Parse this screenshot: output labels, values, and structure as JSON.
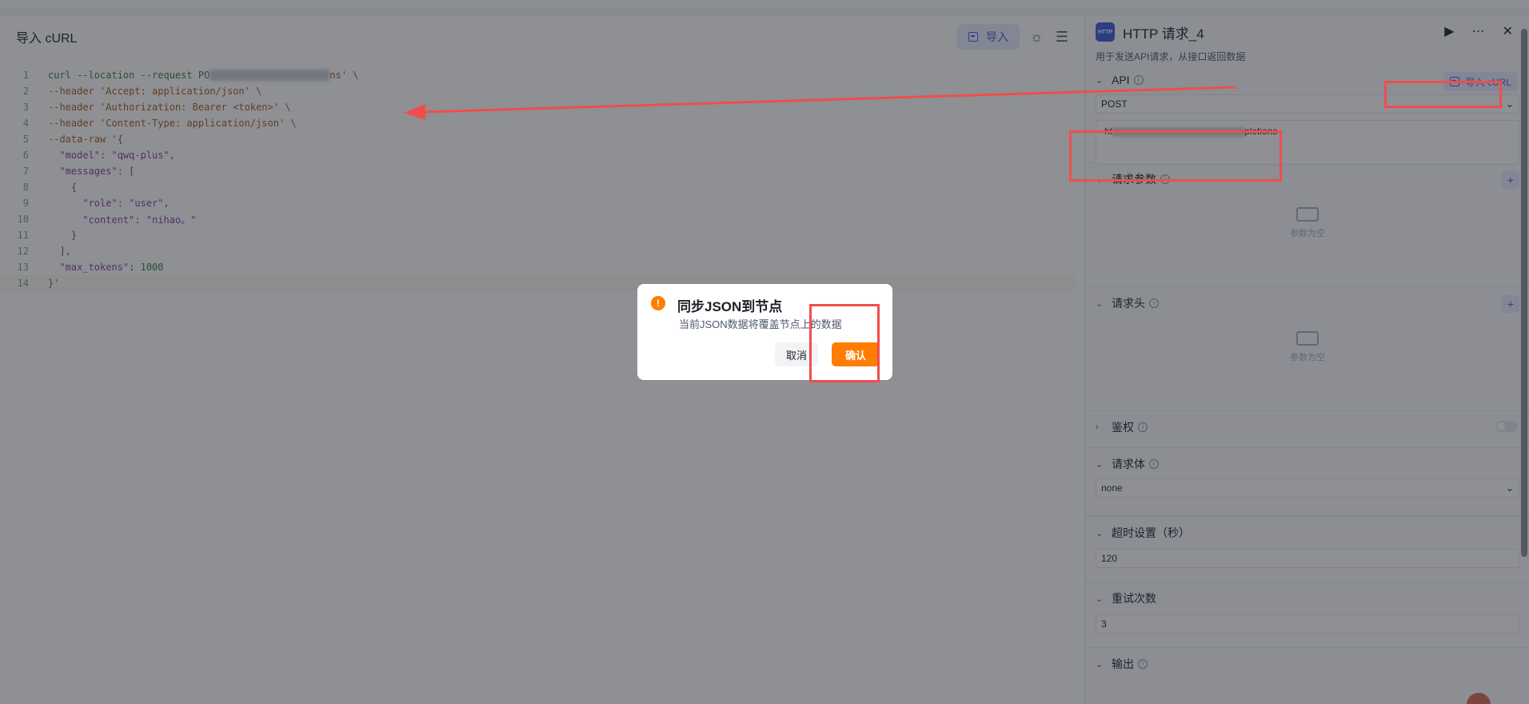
{
  "editor": {
    "title": "导入 cURL",
    "import_label": "导入",
    "lines": [
      {
        "n": "1"
      },
      {
        "n": "2"
      },
      {
        "n": "3"
      },
      {
        "n": "4"
      },
      {
        "n": "5"
      },
      {
        "n": "6"
      },
      {
        "n": "7"
      },
      {
        "n": "8"
      },
      {
        "n": "9"
      },
      {
        "n": "10"
      },
      {
        "n": "11"
      },
      {
        "n": "12"
      },
      {
        "n": "13"
      },
      {
        "n": "14"
      }
    ],
    "code": {
      "l1_cmd": "curl --location --request PO",
      "l1_tail": "ns' \\",
      "l2": "--header 'Accept: application/json' \\",
      "l3": "--header 'Authorization: Bearer <token>' \\",
      "l4": "--header 'Content-Type: application/json' \\",
      "l5_opt": "--data-raw '",
      "l5_brace": "{",
      "l6_key": "\"model\"",
      "l6_val": ": \"qwq-plus\",",
      "l7_key": "\"messages\"",
      "l7_val": ": [",
      "l8": "{",
      "l9_key": "\"role\"",
      "l9_val": ": \"user\",",
      "l10_key": "\"content\"",
      "l10_val": ": \"nihao。\"",
      "l11": "}",
      "l12": "],",
      "l13_key": "\"max_tokens\"",
      "l13_val": "1000",
      "l14": "}'"
    }
  },
  "node": {
    "title": "HTTP 请求_4",
    "logo_text": "HTTP",
    "description": "用于发送API请求，从接口返回数据",
    "api_label": "API",
    "import_curl_label": "导入 cURL",
    "method": "POST",
    "url_prefix": "ht",
    "url_suffix": "pletions",
    "params_label": "请求参数",
    "params_empty": "参数为空",
    "headers_label": "请求头",
    "headers_empty": "参数为空",
    "auth_label": "鉴权",
    "body_label": "请求体",
    "body_type": "none",
    "timeout_label": "超时设置（秒）",
    "timeout_value": "120",
    "retry_label": "重试次数",
    "retry_value": "3",
    "output_label": "输出"
  },
  "dialog": {
    "title": "同步JSON到节点",
    "message": "当前JSON数据将覆盖节点上的数据",
    "cancel_label": "取消",
    "confirm_label": "确认"
  },
  "colors": {
    "accent": "#ff7d00",
    "annotation": "#f04d4d",
    "primary": "#4e5bd6"
  }
}
